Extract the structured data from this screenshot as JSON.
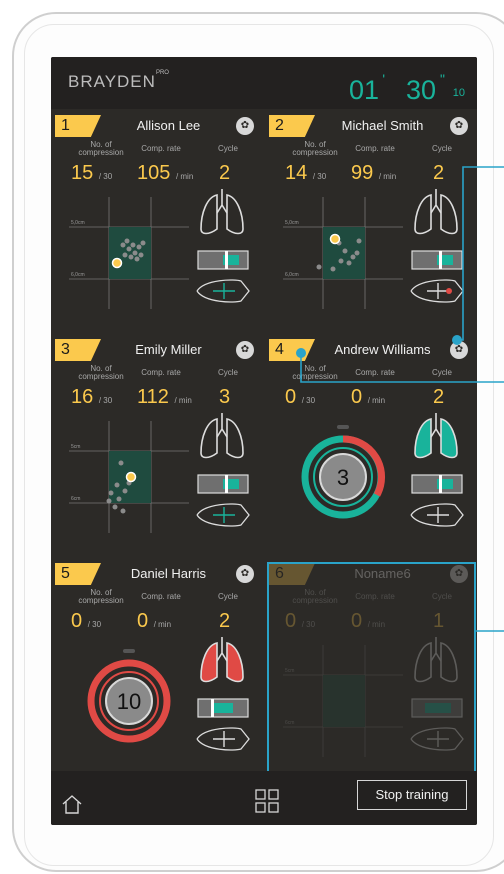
{
  "app": {
    "logo": "BRAYDEN",
    "logo_sup": "PRO",
    "timer": {
      "minutes": "01",
      "seconds": "30",
      "centis": "10"
    }
  },
  "labels": {
    "compressions": "No. of compression",
    "rate": "Comp. rate",
    "cycle": "Cycle",
    "per30": "/ 30",
    "permin": "/ min"
  },
  "trainees": [
    {
      "num": "1",
      "name": "Allison Lee",
      "compressions": "15",
      "rate": "105",
      "cycle": "2"
    },
    {
      "num": "2",
      "name": "Michael Smith",
      "compressions": "14",
      "rate": "99",
      "cycle": "2"
    },
    {
      "num": "3",
      "name": "Emily Miller",
      "compressions": "16",
      "rate": "112",
      "cycle": "3"
    },
    {
      "num": "4",
      "name": "Andrew Williams",
      "compressions": "0",
      "rate": "0",
      "cycle": "2",
      "countdown": "3"
    },
    {
      "num": "5",
      "name": "Daniel Harris",
      "compressions": "0",
      "rate": "0",
      "cycle": "2",
      "countdown": "10"
    },
    {
      "num": "6",
      "name": "Noname6",
      "compressions": "0",
      "rate": "0",
      "cycle": "1"
    }
  ],
  "plot_labels": {
    "y_top_a": "5,0cm",
    "y_bot_a": "6,0cm",
    "y_top_b": "5cm",
    "y_bot_b": "6cm"
  },
  "bottom": {
    "stop_label": "Stop training"
  },
  "colors": {
    "accent": "#19b39b",
    "badge": "#fbc94d",
    "alert": "#e04a45",
    "callout": "#2aa3c9"
  }
}
